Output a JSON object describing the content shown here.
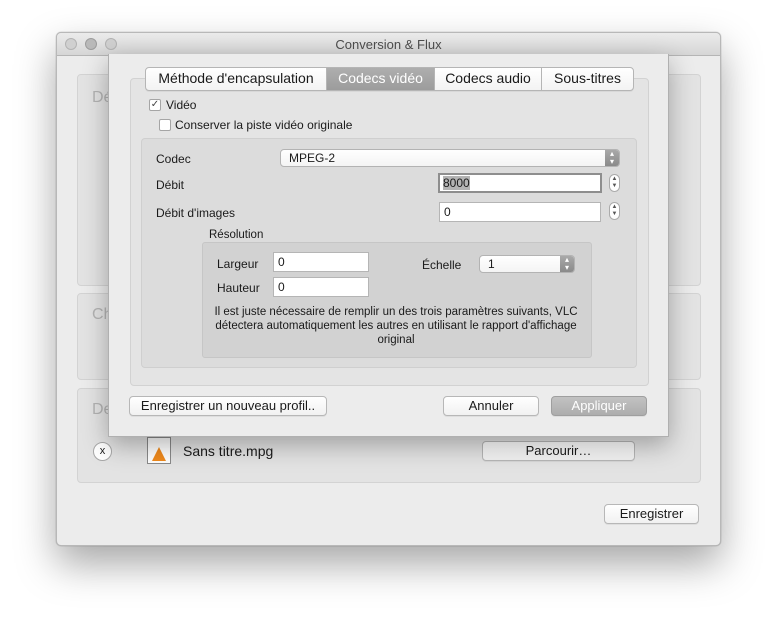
{
  "window": {
    "title": "Conversion & Flux",
    "group_labels": [
      "Dé",
      "Ch",
      "De"
    ],
    "file_name": "Sans titre.mpg",
    "remove_label": "x",
    "browse_label": "Parcourir…",
    "save_label": "Enregistrer"
  },
  "sheet": {
    "tabs": [
      {
        "label": "Méthode d'encapsulation",
        "active": false
      },
      {
        "label": "Codecs vidéo",
        "active": true
      },
      {
        "label": "Codecs audio",
        "active": false
      },
      {
        "label": "Sous-titres",
        "active": false
      }
    ],
    "video_checkbox": {
      "label": "Vidéo",
      "checked": true
    },
    "keep_track_checkbox": {
      "label": "Conserver la piste vidéo originale",
      "checked": false
    },
    "codec": {
      "label": "Codec",
      "value": "MPEG-2"
    },
    "bitrate": {
      "label": "Débit",
      "value": "8000"
    },
    "framerate": {
      "label": "Débit d'images",
      "value": "0"
    },
    "resolution": {
      "title": "Résolution",
      "width_label": "Largeur",
      "width_value": "0",
      "height_label": "Hauteur",
      "height_value": "0",
      "scale_label": "Échelle",
      "scale_value": "1",
      "note": "Il est juste nécessaire de remplir un des trois paramètres suivants, VLC détectera automatiquement les autres en utilisant le rapport d'affichage original"
    },
    "new_profile_label": "Enregistrer un nouveau profil..",
    "cancel_label": "Annuler",
    "apply_label": "Appliquer"
  },
  "icons": {
    "checkmark": "checkmark-icon",
    "stepper": "stepper-icon",
    "popup_arrows": "popup-arrows-icon",
    "file": "vlc-file-icon"
  }
}
